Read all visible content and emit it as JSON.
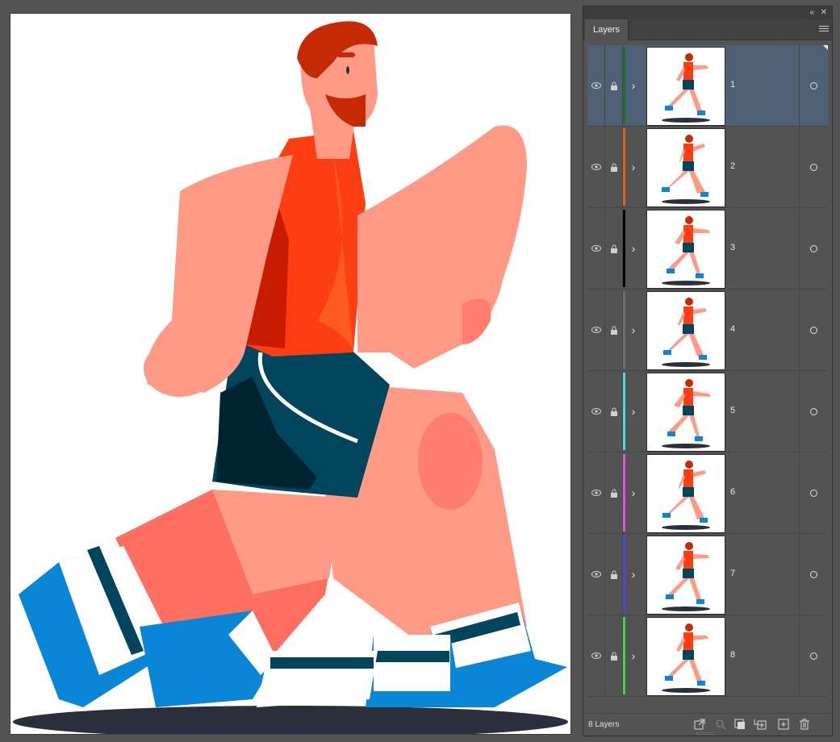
{
  "panel": {
    "tab_label": "Layers",
    "collapse_icon": "double-chevron-left-icon",
    "close_icon": "close-icon",
    "menu_icon": "hamburger-menu-icon"
  },
  "layers": [
    {
      "name": "1",
      "color": "#1f6e2a",
      "selected": true
    },
    {
      "name": "2",
      "color": "#e0621a",
      "selected": false
    },
    {
      "name": "3",
      "color": "#000000",
      "selected": false
    },
    {
      "name": "4",
      "color": "#6e6e6e",
      "selected": false
    },
    {
      "name": "5",
      "color": "#4fd8e6",
      "selected": false
    },
    {
      "name": "6",
      "color": "#e05ad6",
      "selected": false
    },
    {
      "name": "7",
      "color": "#4a4ad0",
      "selected": false
    },
    {
      "name": "8",
      "color": "#48d14f",
      "selected": false
    }
  ],
  "footer": {
    "layer_count": "8 Layers",
    "buttons": [
      "export-for-screens-icon",
      "locate-object-icon",
      "make-clipping-mask-icon",
      "create-sublayer-icon",
      "create-new-layer-icon",
      "delete-icon"
    ]
  },
  "colors": {
    "skin": "#ff9a86",
    "skin_dark": "#ff6f61",
    "shirt": "#ff3d12",
    "shirt_dark": "#c81c00",
    "shorts": "#00455c",
    "shorts_dark": "#002330",
    "hair": "#c52a05",
    "shoe_blue": "#0a86d6",
    "shadow": "#2a2f3b"
  }
}
